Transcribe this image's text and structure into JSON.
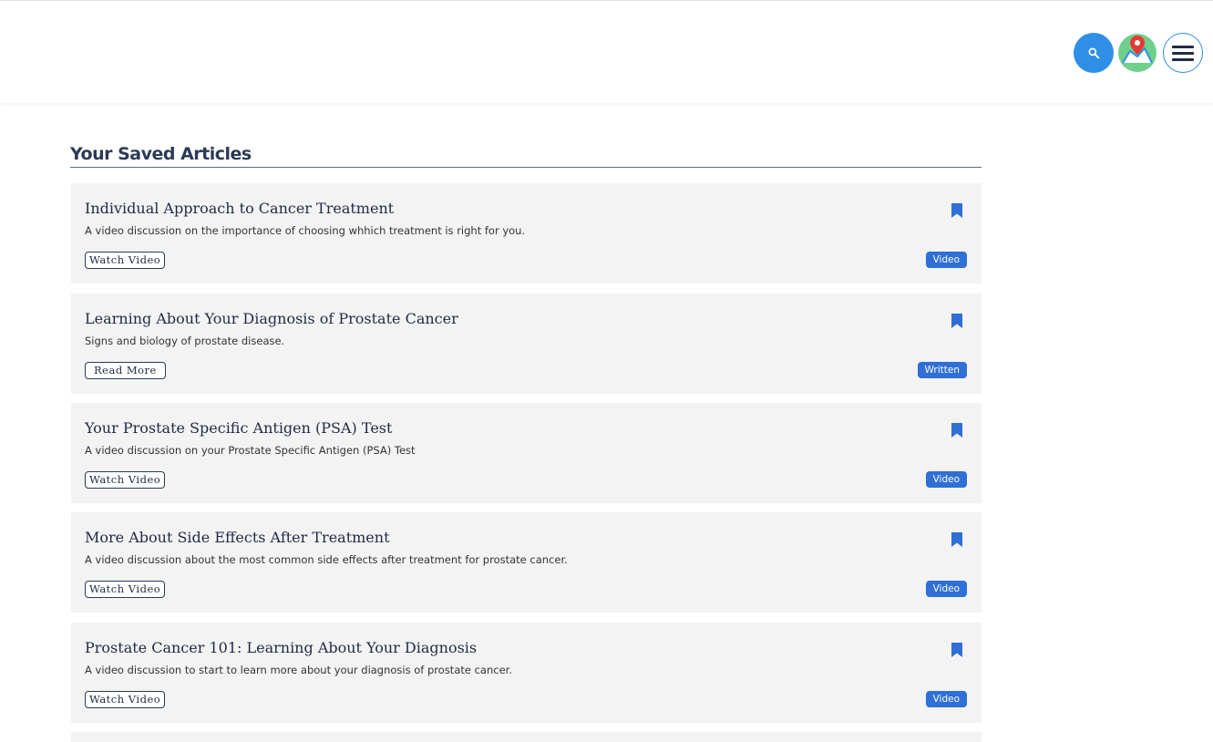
{
  "header": {
    "search_icon": "search-icon",
    "map_icon": "map-pin-icon",
    "menu_icon": "hamburger-menu-icon",
    "accent_color": "#2f8fe6"
  },
  "main": {
    "section_title": "Your Saved Articles",
    "articles": [
      {
        "title": "Individual Approach to Cancer Treatment",
        "description": "A video discussion on the importance of choosing whhich treatment is right for you.",
        "action_label": "Watch Video",
        "badge": "Video"
      },
      {
        "title": "Learning About Your Diagnosis of Prostate Cancer",
        "description": "Signs and biology of prostate disease.",
        "action_label": "Read More",
        "badge": "Written"
      },
      {
        "title": "Your Prostate Specific Antigen (PSA) Test",
        "description": "A video discussion on your Prostate Specific Antigen (PSA) Test",
        "action_label": "Watch Video",
        "badge": "Video"
      },
      {
        "title": "More About Side Effects After Treatment",
        "description": "A video discussion about the most common side effects after treatment for prostate cancer.",
        "action_label": "Watch Video",
        "badge": "Video"
      },
      {
        "title": "Prostate Cancer 101: Learning About Your Diagnosis",
        "description": "A video discussion to start to learn more about your diagnosis of prostate cancer.",
        "action_label": "Watch Video",
        "badge": "Video"
      }
    ]
  }
}
